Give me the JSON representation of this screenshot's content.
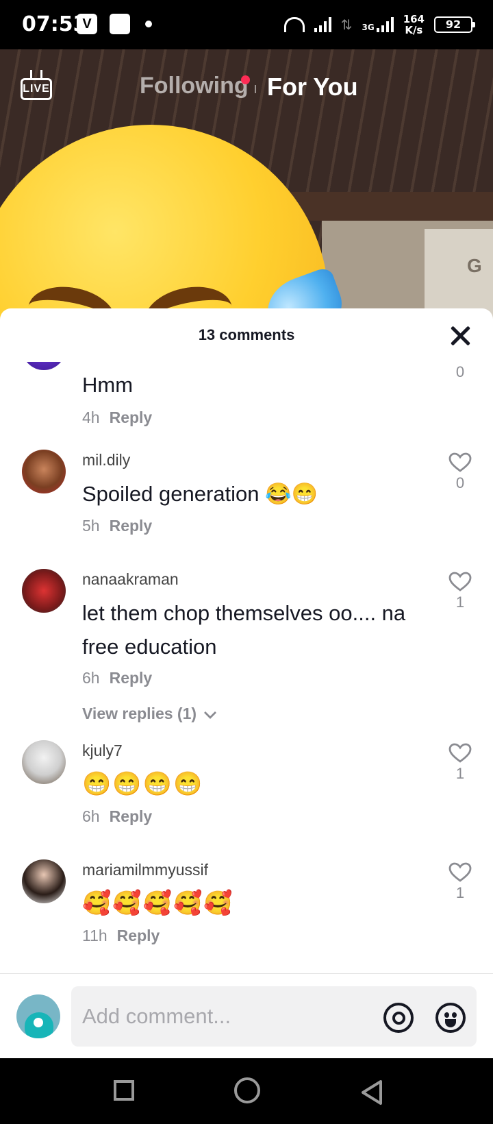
{
  "status_bar": {
    "time": "07:53",
    "net_type": "3G",
    "speed_value": "164",
    "speed_unit": "K/s",
    "battery": "92"
  },
  "feed": {
    "live_label": "LIVE",
    "tab_following": "Following",
    "tab_for_you": "For You",
    "video_sign_text": "G"
  },
  "comments_sheet": {
    "title": "13 comments",
    "reply_label": "Reply",
    "view_replies_label": "View replies (1)",
    "comments": [
      {
        "username": "",
        "text": "Hmm",
        "time": "4h",
        "likes": "0"
      },
      {
        "username": "mil.dily",
        "text": "Spoiled generation 😂😁",
        "time": "5h",
        "likes": "0"
      },
      {
        "username": "nanaakraman",
        "text": "let them chop themselves oo.... na free education",
        "time": "6h",
        "likes": "1"
      },
      {
        "username": "kjuly7",
        "text": "😁😁😁😁",
        "time": "6h",
        "likes": "1"
      },
      {
        "username": "mariamilmmyussif",
        "text": "🥰🥰🥰🥰🥰",
        "time": "11h",
        "likes": "1"
      }
    ]
  },
  "composer": {
    "placeholder": "Add comment..."
  },
  "icons": {
    "live": "live-tv-icon",
    "close": "close-icon",
    "like": "heart-outline-icon",
    "mention": "at-sign-icon",
    "emoji": "smile-icon"
  },
  "colors": {
    "accent_dot": "#fe2c55",
    "text_primary": "#161823",
    "text_secondary": "#8a8b91"
  }
}
